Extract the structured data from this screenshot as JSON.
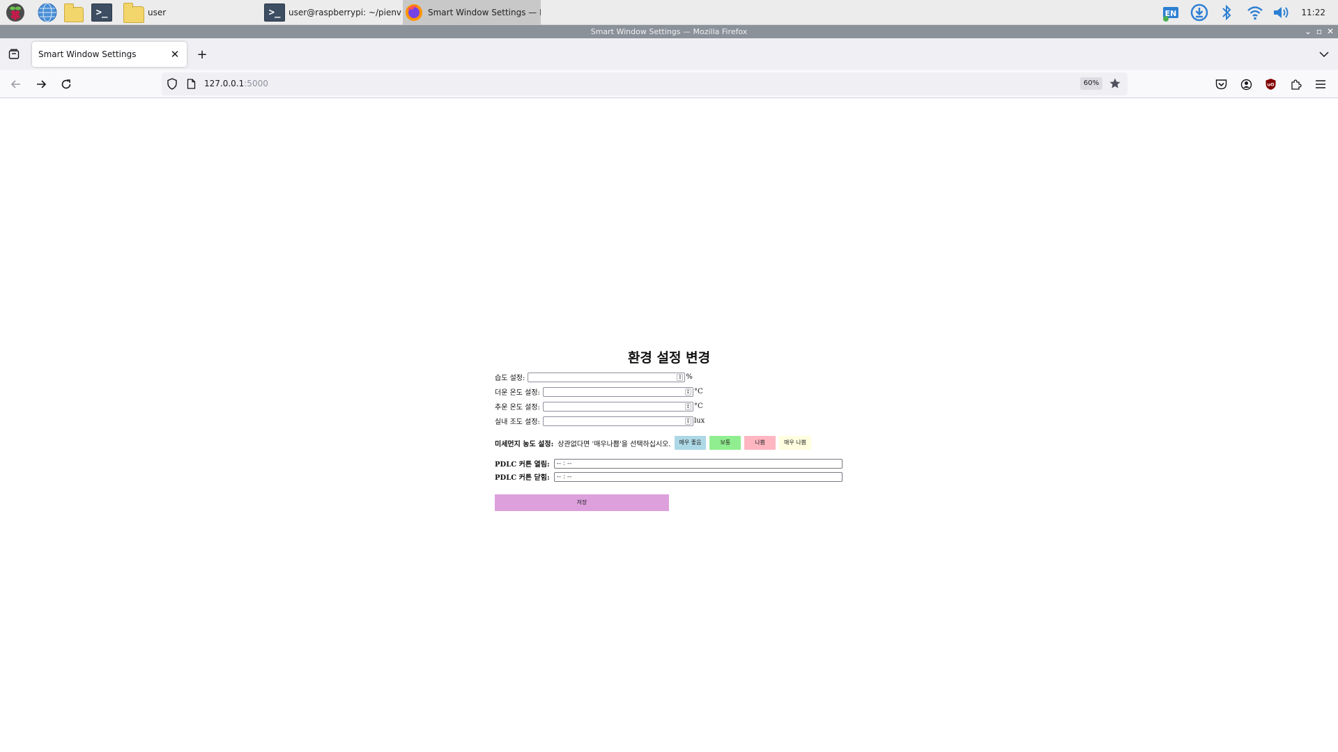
{
  "taskbar": {
    "launchers": [
      {
        "name": "raspberry-menu",
        "icon": "raspberry-icon"
      },
      {
        "name": "web-browser",
        "icon": "globe-icon"
      },
      {
        "name": "file-manager",
        "icon": "folder-icon"
      },
      {
        "name": "terminal",
        "icon": "terminal-icon"
      }
    ],
    "tasks": [
      {
        "label": "user",
        "icon": "folder-icon"
      },
      {
        "label": "user@raspberrypi: ~/pienv/myfla...",
        "icon": "terminal-icon"
      },
      {
        "label": "Smart Window Settings — Mozill...",
        "icon": "firefox-icon"
      }
    ],
    "tray": {
      "language": "EN",
      "clock": "11:22"
    }
  },
  "window": {
    "title": "Smart Window Settings — Mozilla Firefox"
  },
  "browser": {
    "tab_title": "Smart Window Settings",
    "url_host": "127.0.0.1",
    "url_port": ":5000",
    "zoom": "60%"
  },
  "page": {
    "title": "환경 설정 변경",
    "humidity": {
      "label": "습도 설정:",
      "value": "",
      "unit": "%"
    },
    "hot_temp": {
      "label": "더운 온도 설정:",
      "value": "",
      "unit": "°C"
    },
    "cold_temp": {
      "label": "추운 온도 설정:",
      "value": "",
      "unit": "°C"
    },
    "illuminance": {
      "label": "실내 조도 설정:",
      "value": "",
      "unit": "lux"
    },
    "dust": {
      "label": "미세먼지 농도 설정:",
      "hint": "상관없다면 '매우나쁨'을 선택하십시오.",
      "options": [
        {
          "label": "매우 좋음",
          "color": "#add8e6"
        },
        {
          "label": "보통",
          "color": "#90ee90"
        },
        {
          "label": "나쁨",
          "color": "#ffb6c1"
        },
        {
          "label": "매우 나쁨",
          "color": "#ffffe0"
        }
      ]
    },
    "pdlc_open": {
      "label": "PDLC 커튼 열림:",
      "value": "-- : --"
    },
    "pdlc_close": {
      "label": "PDLC 커튼 닫힘:",
      "value": "-- : --"
    },
    "save_label": "저장"
  }
}
